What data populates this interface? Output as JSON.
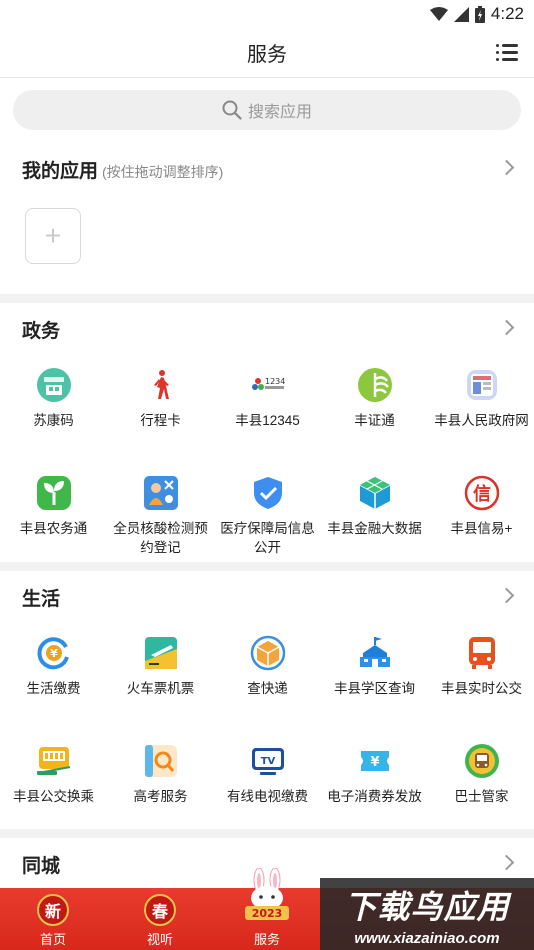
{
  "status": {
    "time": "4:22"
  },
  "header": {
    "title": "服务"
  },
  "search": {
    "placeholder": "搜索应用"
  },
  "my_apps": {
    "title": "我的应用",
    "subtitle": "(按住拖动调整排序)",
    "add_symbol": "+"
  },
  "sections": {
    "zhengwu": {
      "title": "政务",
      "items": [
        {
          "label": "苏康码",
          "icon": "sukang-code-icon"
        },
        {
          "label": "行程卡",
          "icon": "walking-person-icon"
        },
        {
          "label": "丰县12345",
          "icon": "hotline-12345-icon"
        },
        {
          "label": "丰证通",
          "icon": "leaf-globe-icon"
        },
        {
          "label": "丰县人民政府网",
          "icon": "gov-website-icon"
        },
        {
          "label": "丰县农务通",
          "icon": "sprout-icon"
        },
        {
          "label": "全员核酸检测预约登记",
          "icon": "nucleic-test-icon"
        },
        {
          "label": "医疗保障局信息公开",
          "icon": "shield-check-icon"
        },
        {
          "label": "丰县金融大数据",
          "icon": "cube-data-icon"
        },
        {
          "label": "丰县信易+",
          "icon": "xin-credit-icon"
        }
      ]
    },
    "shenghuo": {
      "title": "生活",
      "items": [
        {
          "label": "生活缴费",
          "icon": "yuan-refresh-icon"
        },
        {
          "label": "火车票机票",
          "icon": "plane-ticket-icon"
        },
        {
          "label": "查快递",
          "icon": "parcel-box-icon"
        },
        {
          "label": "丰县学区查询",
          "icon": "school-building-icon"
        },
        {
          "label": "丰县实时公交",
          "icon": "bus-icon"
        },
        {
          "label": "丰县公交换乘",
          "icon": "bus-card-icon"
        },
        {
          "label": "高考服务",
          "icon": "exam-search-icon"
        },
        {
          "label": "有线电视缴费",
          "icon": "tv-icon"
        },
        {
          "label": "电子消费券发放",
          "icon": "coupon-icon"
        },
        {
          "label": "巴士管家",
          "icon": "bus-butler-icon"
        }
      ]
    },
    "tongcheng": {
      "title": "同城"
    }
  },
  "bottom_nav": {
    "tabs": [
      {
        "label": "首页",
        "glyph": "新"
      },
      {
        "label": "视听",
        "glyph": "春"
      },
      {
        "label": "服务",
        "badge": "2023"
      }
    ]
  },
  "watermark": {
    "main": "下载鸟应用",
    "sub": "www.xiazainiao.com"
  },
  "colors": {
    "accent_red": "#e83b2e",
    "nav_gold": "#f3c24a"
  }
}
